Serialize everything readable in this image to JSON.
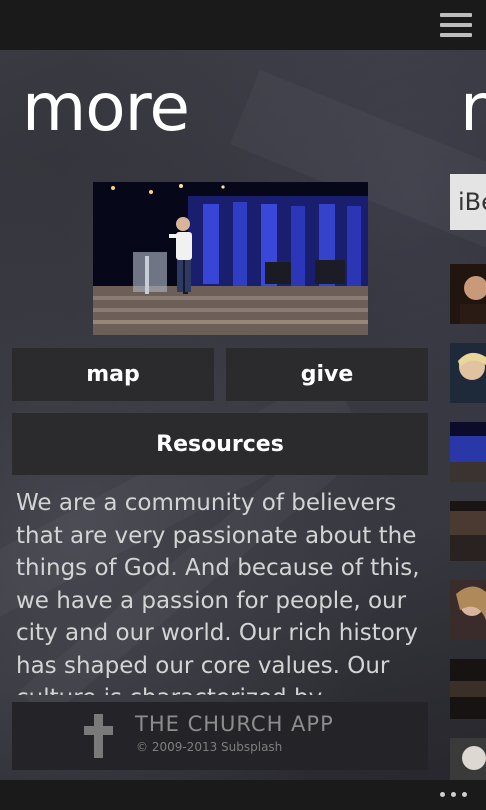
{
  "header": {
    "menu_icon": "hamburger-menu-icon"
  },
  "page": {
    "title": "more",
    "next_title_partial": "n"
  },
  "hero": {
    "image_description": "pastor on stage"
  },
  "buttons": {
    "map": "map",
    "give": "give",
    "resources": "Resources"
  },
  "description": "We are a community of believers that are very passionate about the things of God. And because of this, we have a passion for people, our city and our world. Our rich history has shaped our core values. Our culture is characterized by worship, the",
  "footer": {
    "icon": "cross-icon",
    "brand": "THE CHURCH APP",
    "copyright": "© 2009-2013 Subsplash"
  },
  "side_panel": {
    "partial_text": "iBe",
    "thumbnails": [
      "person-thumb-1",
      "person-thumb-2",
      "stage-thumb-3",
      "stage-thumb-4",
      "person-thumb-5",
      "stage-thumb-6",
      "person-thumb-7"
    ]
  },
  "bottom_bar": {
    "more_icon": "ellipsis-icon"
  },
  "colors": {
    "background": "#2e2e34",
    "topbar": "#1a1a1a",
    "button": "#2b2b2e",
    "text": "#ffffff",
    "tile": "#e4e4e4"
  }
}
